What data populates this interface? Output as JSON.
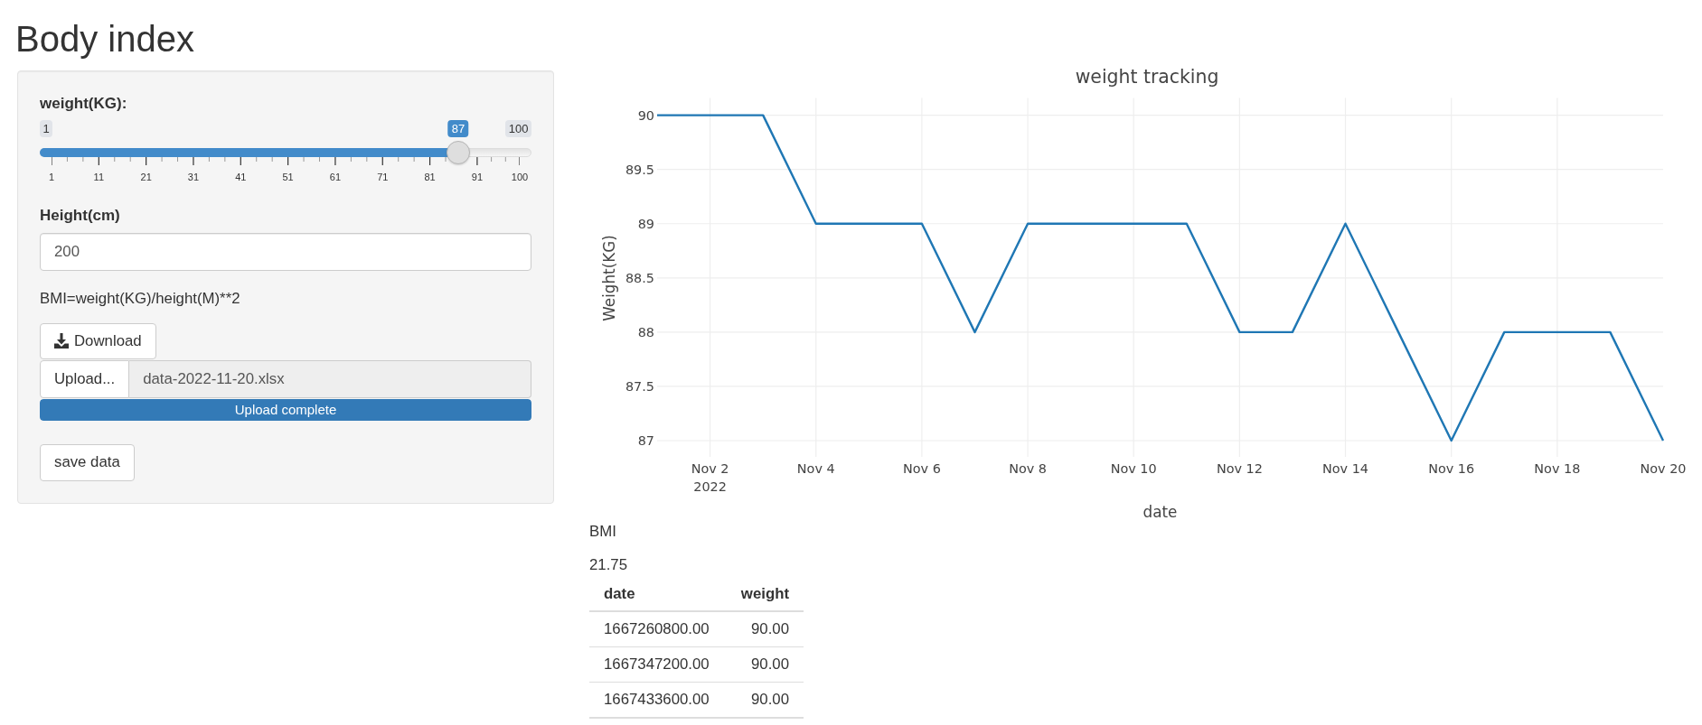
{
  "page": {
    "title": "Body index"
  },
  "sidebar": {
    "weight_slider": {
      "label": "weight(KG):",
      "min_label": "1",
      "max_label": "100",
      "value_label": "87",
      "level": 0.8687,
      "grid_labels": [
        "1",
        "11",
        "21",
        "31",
        "41",
        "51",
        "61",
        "71",
        "81",
        "91",
        "100"
      ]
    },
    "height_input": {
      "label": "Height(cm)",
      "value": "200"
    },
    "formula": "BMI=weight(KG)/height(M)**2",
    "download_button": {
      "label": "Download"
    },
    "upload": {
      "button_label": "Upload...",
      "file_name": "data-2022-11-20.xlsx",
      "progress": {
        "level": 1,
        "label": "Upload complete"
      }
    },
    "save_button": {
      "label": "save data"
    }
  },
  "main": {
    "chart": {
      "chart_data": {
        "type": "line",
        "title": "weight tracking",
        "xlabel": "date",
        "ylabel": "Weight(KG)",
        "x": [
          "2022-11-01",
          "2022-11-02",
          "2022-11-03",
          "2022-11-04",
          "2022-11-05",
          "2022-11-06",
          "2022-11-07",
          "2022-11-08",
          "2022-11-09",
          "2022-11-10",
          "2022-11-11",
          "2022-11-12",
          "2022-11-13",
          "2022-11-14",
          "2022-11-15",
          "2022-11-16",
          "2022-11-17",
          "2022-11-18",
          "2022-11-19",
          "2022-11-20"
        ],
        "series": [
          {
            "color": "#1f77b4",
            "values": [
              90,
              90,
              90,
              89,
              89,
              89,
              88,
              89,
              89,
              89,
              89,
              88,
              88,
              89,
              88,
              87,
              88,
              88,
              88,
              87
            ]
          }
        ],
        "xlim": [
          "2022-11-01",
          "2022-11-20"
        ],
        "ylim": [
          86.85,
          90.16
        ],
        "xticks": [
          {
            "value": "2022-11-02",
            "label": "Nov 2\n2022"
          },
          {
            "value": "2022-11-04",
            "label": "Nov 4"
          },
          {
            "value": "2022-11-06",
            "label": "Nov 6"
          },
          {
            "value": "2022-11-08",
            "label": "Nov 8"
          },
          {
            "value": "2022-11-10",
            "label": "Nov 10"
          },
          {
            "value": "2022-11-12",
            "label": "Nov 12"
          },
          {
            "value": "2022-11-14",
            "label": "Nov 14"
          },
          {
            "value": "2022-11-16",
            "label": "Nov 16"
          },
          {
            "value": "2022-11-18",
            "label": "Nov 18"
          },
          {
            "value": "2022-11-20",
            "label": "Nov 20"
          }
        ],
        "yticks": [
          87,
          87.5,
          88,
          88.5,
          89,
          89.5,
          90
        ],
        "grid": true
      }
    },
    "bmi": {
      "label": "BMI",
      "value": "21.75"
    },
    "table": {
      "columns": [
        "date",
        "weight"
      ],
      "rows": [
        [
          "1667260800.00",
          "90.00"
        ],
        [
          "1667347200.00",
          "90.00"
        ],
        [
          "1667433600.00",
          "90.00"
        ]
      ]
    }
  }
}
